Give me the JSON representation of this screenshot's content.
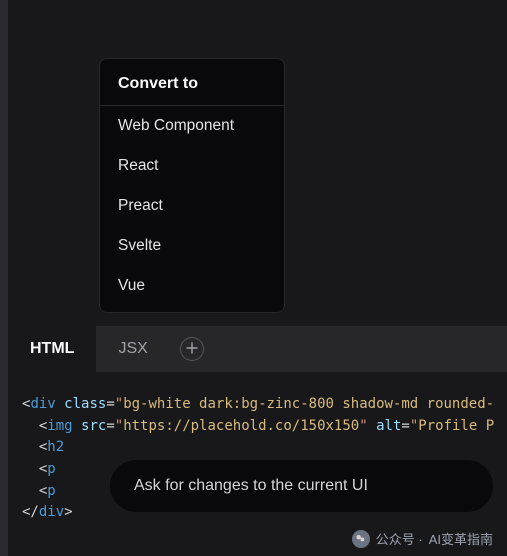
{
  "dropdown": {
    "header": "Convert to",
    "items": [
      "Web Component",
      "React",
      "Preact",
      "Svelte",
      "Vue"
    ]
  },
  "tabs": {
    "items": [
      {
        "label": "HTML",
        "active": true
      },
      {
        "label": "JSX",
        "active": false
      }
    ],
    "add_icon": "plus-icon"
  },
  "code": {
    "line1": {
      "tag": "div",
      "attr": "class",
      "val_prefix": "\"",
      "val_hl": "bg-white dark:bg-zinc-800 shadow-md rounded-"
    },
    "line2": {
      "tag": "img",
      "attr1": "src",
      "val1_hl": "https://placehold.co/150x150",
      "attr2": "alt",
      "val2_hl": "Profile P"
    },
    "line3": {
      "tag_open": "h2"
    },
    "line4": {
      "tag_open_trunc": "p"
    },
    "line5": {
      "tag_open_trunc": "p"
    },
    "line6": {
      "tag_close": "div"
    }
  },
  "prompt": {
    "placeholder": "Ask for changes to the current UI"
  },
  "watermark": {
    "prefix": "公众号 ·",
    "name": "AI变革指南"
  }
}
